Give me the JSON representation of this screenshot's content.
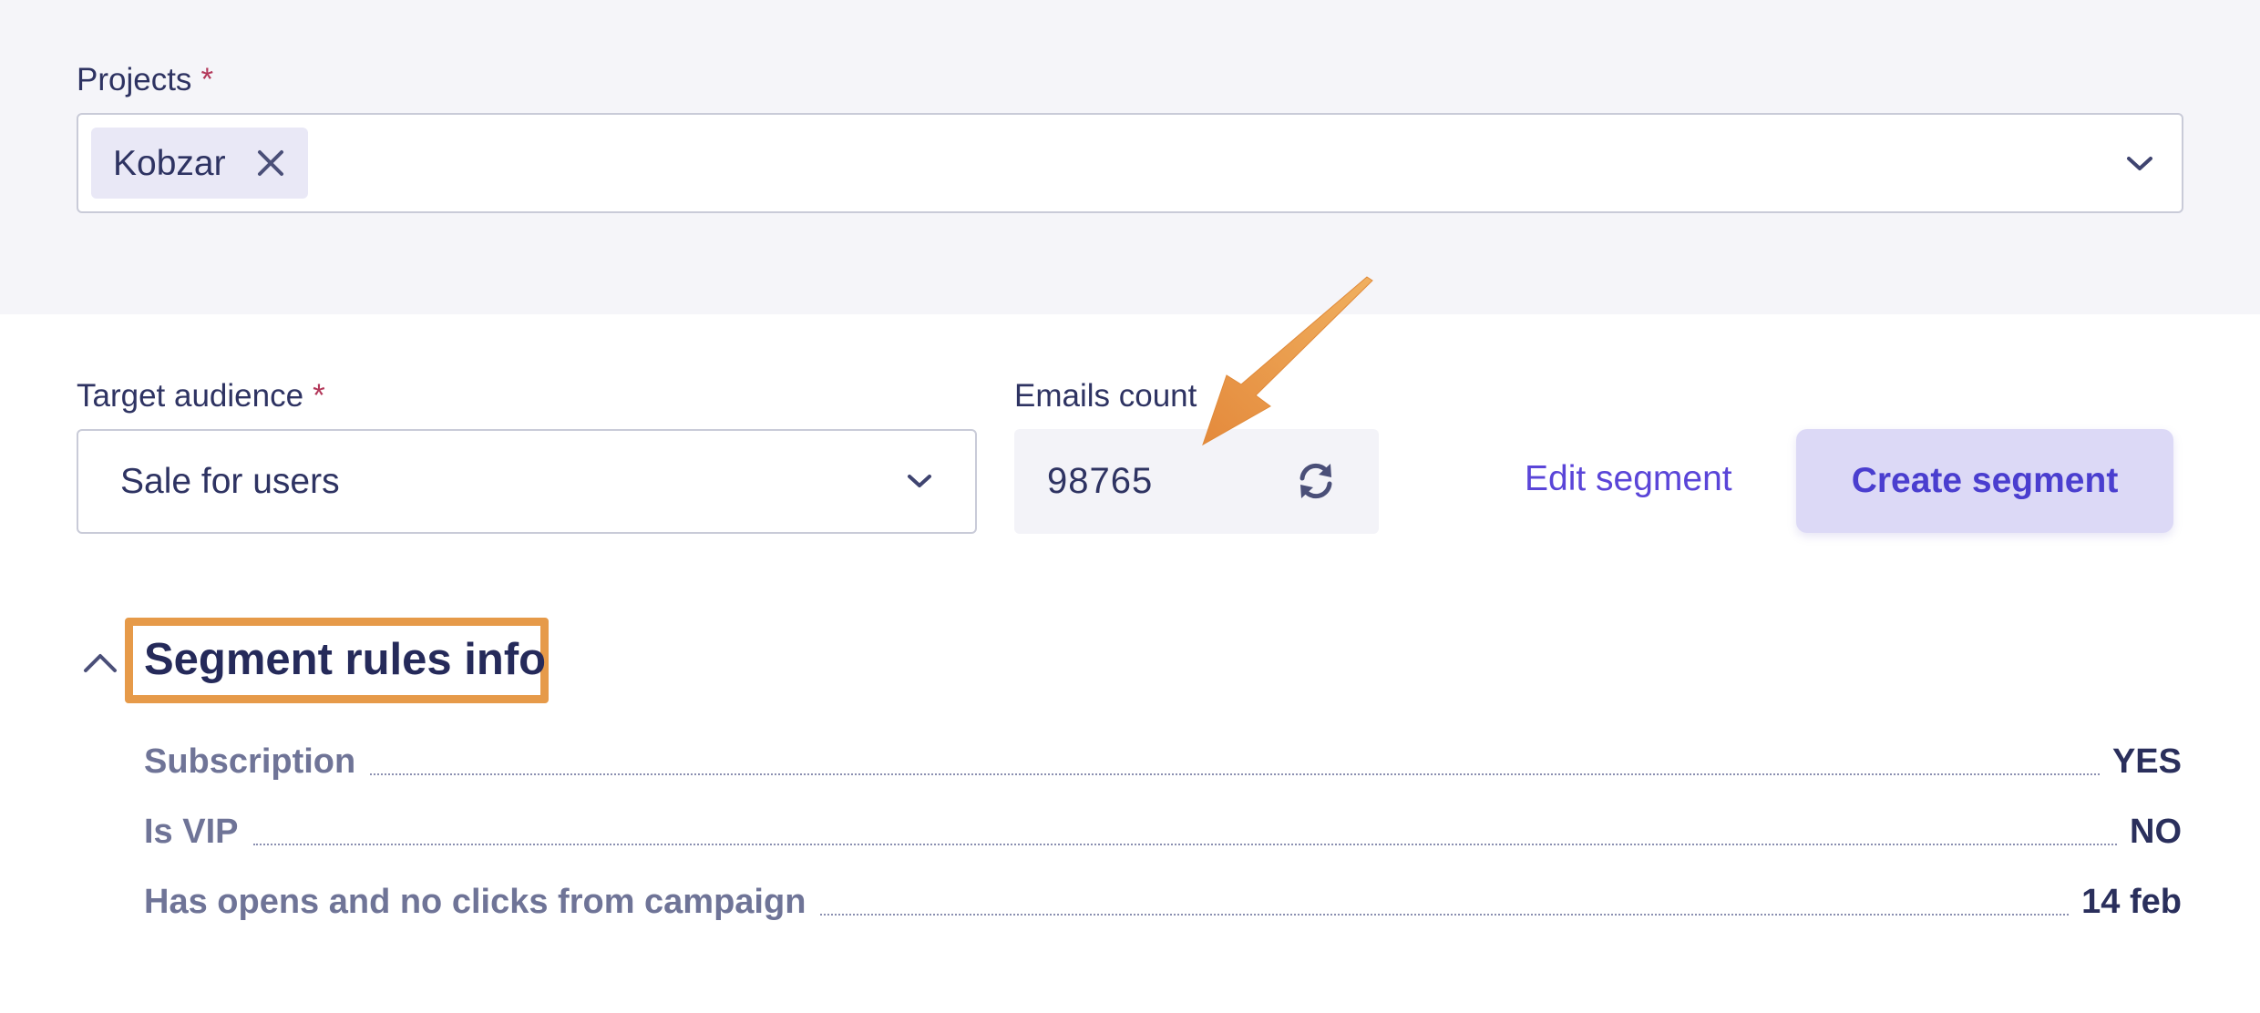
{
  "projects": {
    "label": "Projects",
    "required_mark": "*",
    "selected_chip": "Kobzar"
  },
  "audience": {
    "label": "Target audience",
    "required_mark": "*",
    "value": "Sale for users"
  },
  "emails": {
    "label": "Emails count",
    "value": "98765"
  },
  "actions": {
    "edit_label": "Edit segment",
    "create_label": "Create segment"
  },
  "segment_rules": {
    "title": "Segment rules info",
    "rows": [
      {
        "label": "Subscription",
        "value": "YES"
      },
      {
        "label": "Is VIP",
        "value": "NO"
      },
      {
        "label": "Has opens and no clicks from campaign",
        "value": "14 feb"
      }
    ]
  },
  "icons": {
    "chip_remove": "close-icon",
    "projects_dropdown": "chevron-down-icon",
    "audience_dropdown": "chevron-down-icon",
    "refresh": "refresh-icon",
    "collapse": "chevron-up-icon"
  },
  "colors": {
    "accent": "#5a45d8",
    "button_bg": "#dcd9f6",
    "highlight_border": "#e69a49",
    "required": "#b3385a",
    "band_bg": "#f5f5f9"
  }
}
